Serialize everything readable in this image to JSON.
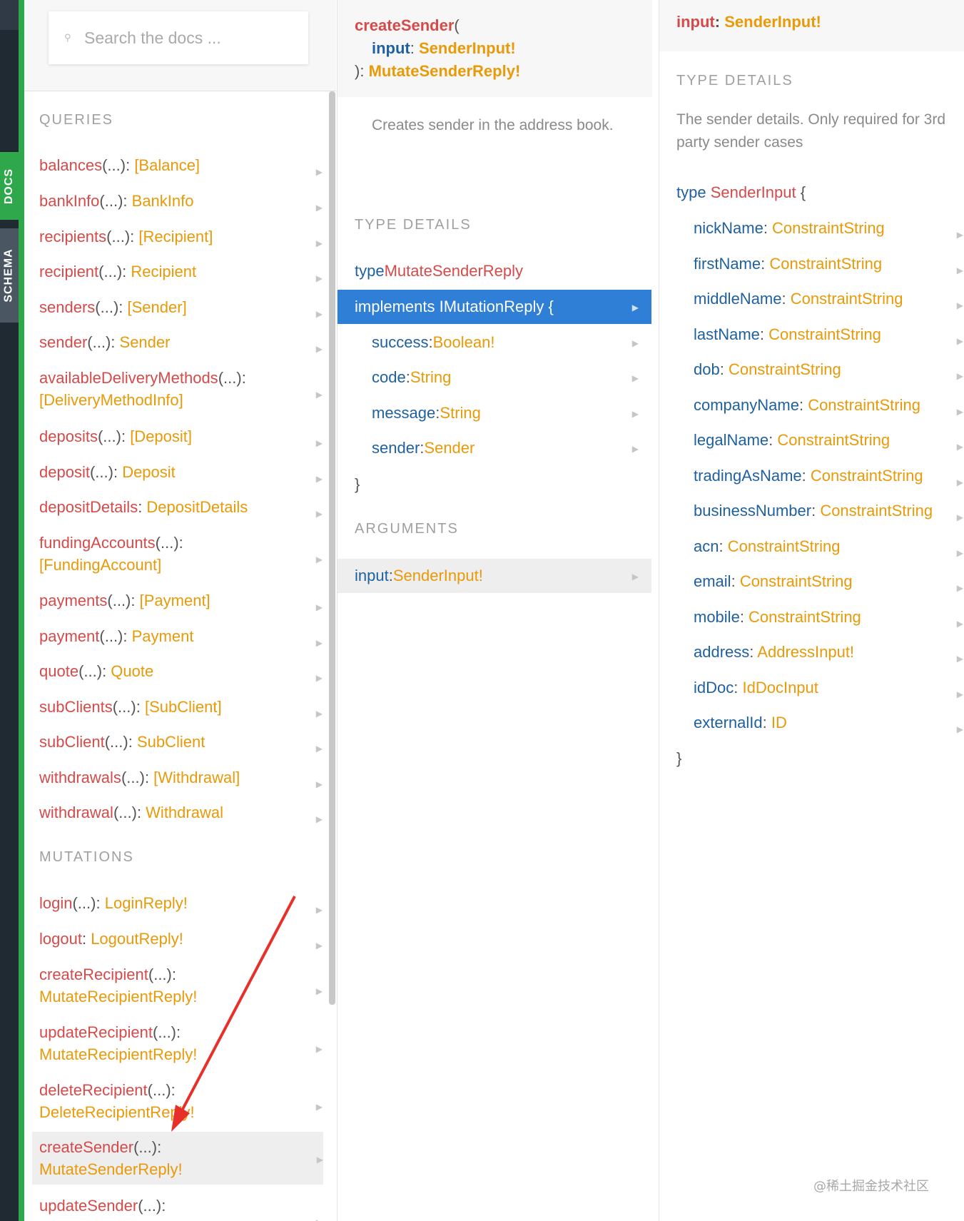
{
  "rail": {
    "docs_label": "DOCS",
    "schema_label": "SCHEMA"
  },
  "search": {
    "placeholder": "Search the docs ..."
  },
  "pane1": {
    "queries_title": "QUERIES",
    "queries": [
      {
        "name": "balances",
        "args": "(...)",
        "sep": ": ",
        "type": "[Balance]"
      },
      {
        "name": "bankInfo",
        "args": "(...)",
        "sep": ": ",
        "type": "BankInfo"
      },
      {
        "name": "recipients",
        "args": "(...)",
        "sep": ": ",
        "type": "[Recipient]"
      },
      {
        "name": "recipient",
        "args": "(...)",
        "sep": ": ",
        "type": "Recipient"
      },
      {
        "name": "senders",
        "args": "(...)",
        "sep": ": ",
        "type": "[Sender]"
      },
      {
        "name": "sender",
        "args": "(...)",
        "sep": ": ",
        "type": "Sender"
      },
      {
        "name": "availableDeliveryMethods",
        "args": "(...)",
        "sep": ":",
        "type": "[DeliveryMethodInfo]"
      },
      {
        "name": "deposits",
        "args": "(...)",
        "sep": ": ",
        "type": "[Deposit]"
      },
      {
        "name": "deposit",
        "args": "(...)",
        "sep": ": ",
        "type": "Deposit"
      },
      {
        "name": "depositDetails",
        "args": "",
        "sep": ": ",
        "type": "DepositDetails"
      },
      {
        "name": "fundingAccounts",
        "args": "(...)",
        "sep": ":",
        "type": "[FundingAccount]"
      },
      {
        "name": "payments",
        "args": "(...)",
        "sep": ": ",
        "type": "[Payment]"
      },
      {
        "name": "payment",
        "args": "(...)",
        "sep": ": ",
        "type": "Payment"
      },
      {
        "name": "quote",
        "args": "(...)",
        "sep": ": ",
        "type": "Quote"
      },
      {
        "name": "subClients",
        "args": "(...)",
        "sep": ": ",
        "type": "[SubClient]"
      },
      {
        "name": "subClient",
        "args": "(...)",
        "sep": ": ",
        "type": "SubClient"
      },
      {
        "name": "withdrawals",
        "args": "(...)",
        "sep": ": ",
        "type": "[Withdrawal]"
      },
      {
        "name": "withdrawal",
        "args": "(...)",
        "sep": ": ",
        "type": "Withdrawal"
      }
    ],
    "mutations_title": "MUTATIONS",
    "mutations": [
      {
        "name": "login",
        "args": "(...)",
        "sep": ": ",
        "type": "LoginReply!"
      },
      {
        "name": "logout",
        "args": "",
        "sep": ": ",
        "type": "LogoutReply!"
      },
      {
        "name": "createRecipient",
        "args": "(...)",
        "sep": ":",
        "type": "MutateRecipientReply!"
      },
      {
        "name": "updateRecipient",
        "args": "(...)",
        "sep": ":",
        "type": "MutateRecipientReply!"
      },
      {
        "name": "deleteRecipient",
        "args": "(...)",
        "sep": ":",
        "type": "DeleteRecipientReply!"
      },
      {
        "name": "createSender",
        "args": "(...)",
        "sep": ":",
        "type": "MutateSenderReply!"
      },
      {
        "name": "updateSender",
        "args": "(...)",
        "sep": ":",
        "type": ""
      }
    ]
  },
  "pane2": {
    "sig_name": "createSender",
    "sig_open": "(",
    "sig_arg_name": "input",
    "sig_arg_type": "SenderInput!",
    "sig_close": "): ",
    "sig_return": "MutateSenderReply!",
    "description": "Creates sender in the address book.",
    "type_details_title": "TYPE DETAILS",
    "type_keyword": "type ",
    "type_name": "MutateSenderReply",
    "implements_label": "implements IMutationReply {",
    "fields": [
      {
        "name": "success",
        "type": "Boolean!"
      },
      {
        "name": "code",
        "type": "String"
      },
      {
        "name": "message",
        "type": "String"
      },
      {
        "name": "sender",
        "type": "Sender"
      }
    ],
    "close_brace": "}",
    "arguments_title": "ARGUMENTS",
    "argument": {
      "name": "input",
      "type": "SenderInput!"
    }
  },
  "pane3": {
    "head_name": "input",
    "head_type": "SenderInput!",
    "type_details_title": "TYPE DETAILS",
    "description": "The sender details. Only required for 3rd party sender cases",
    "type_keyword": "type ",
    "type_name": "SenderInput",
    "open_brace": " {",
    "fields": [
      {
        "name": "nickName",
        "type": "ConstraintString"
      },
      {
        "name": "firstName",
        "type": "ConstraintString"
      },
      {
        "name": "middleName",
        "type": "ConstraintString"
      },
      {
        "name": "lastName",
        "type": "ConstraintString"
      },
      {
        "name": "dob",
        "type": "ConstraintString"
      },
      {
        "name": "companyName",
        "type": "ConstraintString"
      },
      {
        "name": "legalName",
        "type": "ConstraintString"
      },
      {
        "name": "tradingAsName",
        "type": "ConstraintString"
      },
      {
        "name": "businessNumber",
        "type": "ConstraintString"
      },
      {
        "name": "acn",
        "type": "ConstraintString"
      },
      {
        "name": "email",
        "type": "ConstraintString"
      },
      {
        "name": "mobile",
        "type": "ConstraintString"
      },
      {
        "name": "address",
        "type": "AddressInput!"
      },
      {
        "name": "idDoc",
        "type": "IdDocInput"
      },
      {
        "name": "externalId",
        "type": "ID"
      }
    ],
    "close_brace": "}"
  },
  "watermark": "@稀土掘金技术社区",
  "colors": {
    "field_name": "#d64a4a",
    "type_ref": "#e89a09",
    "keyword": "#1f61a0",
    "selected_bg": "#2f7fd6",
    "rail_green": "#2ea84a",
    "annotation_arrow": "#e8302a"
  },
  "icons": {
    "search": "magnifier-icon",
    "row_arrow": "triangle-right-icon"
  }
}
